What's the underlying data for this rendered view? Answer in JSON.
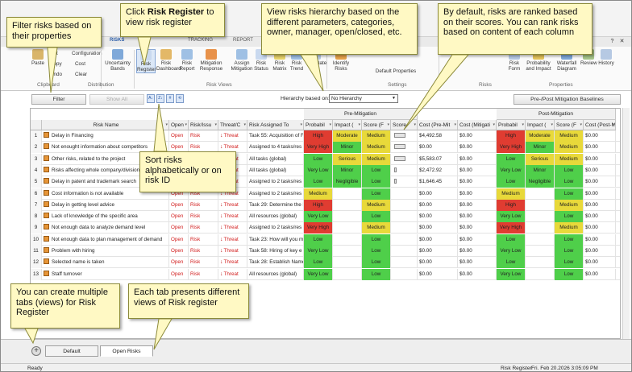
{
  "ribbon": {
    "tabs": [
      "RISKS",
      "TRACKING",
      "REPORT"
    ],
    "groups": [
      "Clipboard",
      "Distribution",
      "Risk Views",
      "Settings",
      "Risks",
      "Properties"
    ],
    "clipboard": {
      "paste": "Paste",
      "cut": "Cut",
      "copy": "Copy",
      "undo": "Undo",
      "clear": "Clear",
      "configuration": "Configuration",
      "cost": "Cost"
    },
    "distribution": {
      "uncertainty_bands": "Uncertainty Bands"
    },
    "views": [
      {
        "line1": "Risk",
        "line2": "Register"
      },
      {
        "line1": "Risk",
        "line2": "Dashboard"
      },
      {
        "line1": "Risk",
        "line2": "Report"
      },
      {
        "line1": "Mitigation",
        "line2": "Response"
      },
      {
        "line1": "Assign",
        "line2": "Mitigation"
      },
      {
        "line1": "Risk",
        "line2": "Status"
      },
      {
        "line1": "Risk",
        "line2": "Matrix"
      },
      {
        "line1": "Risk",
        "line2": "Trend"
      }
    ],
    "other": {
      "calculate": "Calculate",
      "identify_risks": "Identify Risks",
      "default_properties": "Default Properties",
      "matrix": "Matrix",
      "risk_form": "Risk Form",
      "probability_impact": "Probability and Impact",
      "waterfall": "Waterfall Diagram",
      "review": "Review",
      "history": "History"
    }
  },
  "toolbar": {
    "filter": "Filter",
    "show_all": "Show All",
    "hierarchy_label": "Hierarchy based on:",
    "hierarchy_value": "No Hierarchy",
    "baselines": "Pre-/Post Mitigation Baselines"
  },
  "grid": {
    "group_pre": "Pre-Mitigation",
    "group_post": "Post-Mitigation",
    "columns": [
      "Risk Name",
      "Open",
      "Risk/Issu",
      "Threat/C",
      "Risk Assigned To",
      "Probabil",
      "Impact (",
      "Score (F",
      "Score",
      "Cost (Pre-Mit",
      "Cost (Mitigati",
      "Probabil",
      "Impact (",
      "Score (F",
      "Cost (Post-Mi"
    ],
    "rows": [
      {
        "n": "1",
        "name": "Delay in Financing",
        "open": "Open",
        "type": "Risk",
        "threat": "Threat",
        "assigned": "Task 55: Acquisition of F",
        "pre_p": "High",
        "pre_i": "Moderate",
        "pre_s": "Medium",
        "bar": 0.9,
        "cost_pre": "$4,492.58",
        "cost_mit": "$0.00",
        "post_p": "High",
        "post_i": "Moderate",
        "post_s": "Medium",
        "cost_post": "$0.00"
      },
      {
        "n": "2",
        "name": "Not enought information about competitors",
        "open": "Open",
        "type": "Risk",
        "threat": "Threat",
        "assigned": "Assigned to 4 tasks/res",
        "pre_p": "Very High",
        "pre_i": "Minor",
        "pre_s": "Medium",
        "bar": 0.9,
        "cost_pre": "$0.00",
        "cost_mit": "$0.00",
        "post_p": "Very High",
        "post_i": "Minor",
        "post_s": "Medium",
        "cost_post": "$0.00"
      },
      {
        "n": "3",
        "name": "Other risks, related to the project",
        "open": "Open",
        "type": "Risk",
        "threat": "Threat",
        "assigned": "All tasks (global)",
        "pre_p": "Low",
        "pre_i": "Serious",
        "pre_s": "Medium",
        "bar": 0.9,
        "cost_pre": "$5,583.07",
        "cost_mit": "$0.00",
        "post_p": "Low",
        "post_i": "Serious",
        "post_s": "Medium",
        "cost_post": "$0.00"
      },
      {
        "n": "4",
        "name": "Risks affecting whole company/division",
        "open": "Open",
        "type": "Risk",
        "threat": "Threat",
        "assigned": "All tasks (global)",
        "pre_p": "Very Low",
        "pre_i": "Minor",
        "pre_s": "Low",
        "bar": 0.2,
        "cost_pre": "$2,472.92",
        "cost_mit": "$0.00",
        "post_p": "Very Low",
        "post_i": "Minor",
        "post_s": "Low",
        "cost_post": "$0.00"
      },
      {
        "n": "5",
        "name": "Delay in patent and trademark search",
        "open": "Open",
        "type": "Risk",
        "threat": "Threat",
        "assigned": "Assigned to 2 tasks/res",
        "pre_p": "Low",
        "pre_i": "Negligible",
        "pre_s": "Low",
        "bar": 0.2,
        "cost_pre": "$1,646.45",
        "cost_mit": "$0.00",
        "post_p": "Low",
        "post_i": "Negligible",
        "post_s": "Low",
        "cost_post": "$0.00"
      },
      {
        "n": "6",
        "name": "Cost information is not available",
        "open": "Open",
        "type": "Risk",
        "threat": "Threat",
        "assigned": "Assigned to 2 tasks/res",
        "pre_p": "Medium",
        "pre_i": "",
        "pre_s": "Low",
        "bar": 0,
        "cost_pre": "$0.00",
        "cost_mit": "$0.00",
        "post_p": "Medium",
        "post_i": "",
        "post_s": "Low",
        "cost_post": "$0.00"
      },
      {
        "n": "7",
        "name": "Delay in getting level advice",
        "open": "Open",
        "type": "Risk",
        "threat": "Threat",
        "assigned": "Task 29: Determine the l",
        "pre_p": "High",
        "pre_i": "",
        "pre_s": "Medium",
        "bar": 0,
        "cost_pre": "$0.00",
        "cost_mit": "$0.00",
        "post_p": "High",
        "post_i": "",
        "post_s": "Medium",
        "cost_post": "$0.00"
      },
      {
        "n": "8",
        "name": "Lack of knowledge of the specific area",
        "open": "Open",
        "type": "Risk",
        "threat": "Threat",
        "assigned": "All resources (global)",
        "pre_p": "Very Low",
        "pre_i": "",
        "pre_s": "Low",
        "bar": 0,
        "cost_pre": "$0.00",
        "cost_mit": "$0.00",
        "post_p": "Very Low",
        "post_i": "",
        "post_s": "Low",
        "cost_post": "$0.00"
      },
      {
        "n": "9",
        "name": "Not enough data to analyze demand level",
        "open": "Open",
        "type": "Risk",
        "threat": "Threat",
        "assigned": "Assigned to 2 tasks/res",
        "pre_p": "Very High",
        "pre_i": "",
        "pre_s": "Medium",
        "bar": 0,
        "cost_pre": "$0.00",
        "cost_mit": "$0.00",
        "post_p": "Very High",
        "post_i": "",
        "post_s": "Medium",
        "cost_post": "$0.00"
      },
      {
        "n": "10",
        "name": "Not enough data to plan management of demand",
        "open": "Open",
        "type": "Risk",
        "threat": "Threat",
        "assigned": "Task 23: How will you m",
        "pre_p": "Low",
        "pre_i": "",
        "pre_s": "Low",
        "bar": 0,
        "cost_pre": "$0.00",
        "cost_mit": "$0.00",
        "post_p": "Low",
        "post_i": "",
        "post_s": "Low",
        "cost_post": "$0.00"
      },
      {
        "n": "11",
        "name": "Problem with hiring",
        "open": "Open",
        "type": "Risk",
        "threat": "Threat",
        "assigned": "Task 58: Hiring of key e",
        "pre_p": "Very Low",
        "pre_i": "",
        "pre_s": "Low",
        "bar": 0,
        "cost_pre": "$0.00",
        "cost_mit": "$0.00",
        "post_p": "Very Low",
        "post_i": "",
        "post_s": "Low",
        "cost_post": "$0.00"
      },
      {
        "n": "12",
        "name": "Selected name is taken",
        "open": "Open",
        "type": "Risk",
        "threat": "Threat",
        "assigned": "Task 28: Establish Name",
        "pre_p": "Low",
        "pre_i": "",
        "pre_s": "Low",
        "bar": 0,
        "cost_pre": "$0.00",
        "cost_mit": "$0.00",
        "post_p": "Low",
        "post_i": "",
        "post_s": "Low",
        "cost_post": "$0.00"
      },
      {
        "n": "13",
        "name": "Staff turnover",
        "open": "Open",
        "type": "Risk",
        "threat": "Threat",
        "assigned": "All resources (global)",
        "pre_p": "Very Low",
        "pre_i": "",
        "pre_s": "Low",
        "bar": 0,
        "cost_pre": "$0.00",
        "cost_mit": "$0.00",
        "post_p": "Very Low",
        "post_i": "",
        "post_s": "Low",
        "cost_post": "$0.00"
      }
    ]
  },
  "level_colors": {
    "Very High": "#e03c31",
    "High": "#e03c31",
    "Medium": "#e8d93a",
    "Moderate": "#e8d93a",
    "Serious": "#e8d93a",
    "Low": "#4fcf4a",
    "Very Low": "#4fcf4a",
    "Minor": "#4fcf4a",
    "Negligible": "#4fcf4a"
  },
  "callouts": {
    "filter": "Filter risks based on their properties",
    "register_pre": "Click ",
    "register_bold": "Risk Register",
    "register_post": " to view risk register",
    "hierarchy": "View risks hierarchy based on the different parameters, categories, owner, manager, open/closed, etc.",
    "rank": "By default, risks are ranked based on their scores. You can rank risks based on content of each column",
    "sort": "Sort risks alphabetically or on risk ID",
    "tabs": "You can create multiple tabs (views) for Risk Register",
    "each_tab": "Each tab presents different views of Risk register"
  },
  "view_tabs": [
    "Default",
    "Open Risks"
  ],
  "status": {
    "left": "Ready",
    "view": "Risk Register",
    "datetime": "Fri. Feb 20.2026  3:05:09 PM"
  }
}
